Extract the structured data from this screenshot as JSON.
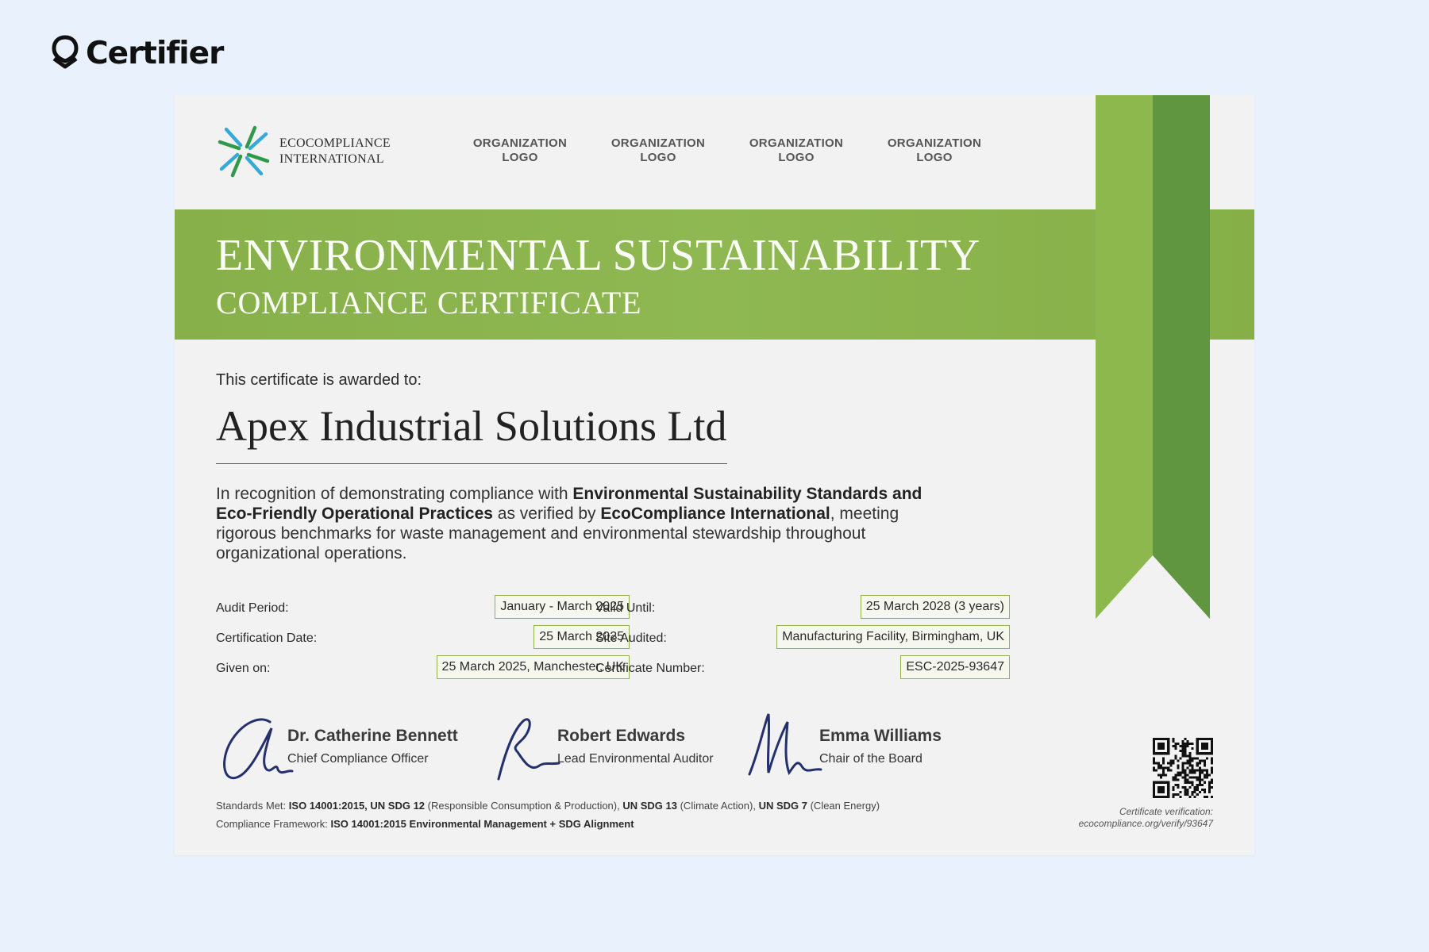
{
  "brand": {
    "name": "Certifier",
    "icon": "certifier-shield-icon"
  },
  "issuer": {
    "logo_icon": "eco-star-icon",
    "name_line1": "ECOCOMPLIANCE",
    "name_line2": "INTERNATIONAL"
  },
  "partner_logos": [
    "ORGANIZATION\nLOGO",
    "ORGANIZATION\nLOGO",
    "ORGANIZATION\nLOGO",
    "ORGANIZATION\nLOGO"
  ],
  "title": {
    "main": "ENVIRONMENTAL SUSTAINABILITY",
    "sub": "COMPLIANCE CERTIFICATE"
  },
  "award": {
    "label": "This certificate is awarded to:",
    "recipient": "Apex Industrial Solutions Ltd"
  },
  "description": {
    "p1": "In recognition of demonstrating compliance with ",
    "b1": "Environmental Sustainability Standards and Eco-Friendly Operational Practices",
    "p2": " as verified by ",
    "b2": "EcoCompliance International",
    "p3": ", meeting rigorous benchmarks for waste management and environmental stewardship throughout organizational operations."
  },
  "details": {
    "audit_period": {
      "label": "Audit Period:",
      "value": "January - March 2025"
    },
    "certification_date": {
      "label": "Certification Date:",
      "value": "25 March 2025"
    },
    "given_on": {
      "label": "Given on:",
      "value": "25 March 2025, Manchester, UK"
    },
    "valid_until": {
      "label": "Valid Until:",
      "value": "25 March 2028 (3 years)"
    },
    "site_audited": {
      "label": "Site Audited:",
      "value": "Manufacturing Facility, Birmingham, UK"
    },
    "certificate_number": {
      "label": "Certificate Number:",
      "value": "ESC-2025-93647"
    }
  },
  "signatories": [
    {
      "name": "Dr. Catherine Bennett",
      "role": "Chief Compliance Officer"
    },
    {
      "name": "Robert Edwards",
      "role": "Lead Environmental Auditor"
    },
    {
      "name": "Emma Williams",
      "role": "Chair of the Board"
    }
  ],
  "standards": {
    "label": "Standards Met: ",
    "s1": "ISO 14001:2015, UN SDG 12",
    "s1_note": " (Responsible Consumption & Production), ",
    "s2": "UN SDG 13",
    "s2_note": " (Climate Action), ",
    "s3": "UN SDG 7",
    "s3_note": " (Clean Energy)",
    "framework_label": "Compliance Framework: ",
    "framework": "ISO 14001:2015 Environmental Management + SDG Alignment"
  },
  "verification": {
    "line1": "Certificate verification:",
    "line2": "ecocompliance.org/verify/93647"
  },
  "colors": {
    "banner_green": "#8bb44e",
    "ribbon_light": "#8db84e",
    "ribbon_dark": "#5f963f",
    "page_background": "#e8f1fc",
    "signature_ink": "#24306e"
  }
}
